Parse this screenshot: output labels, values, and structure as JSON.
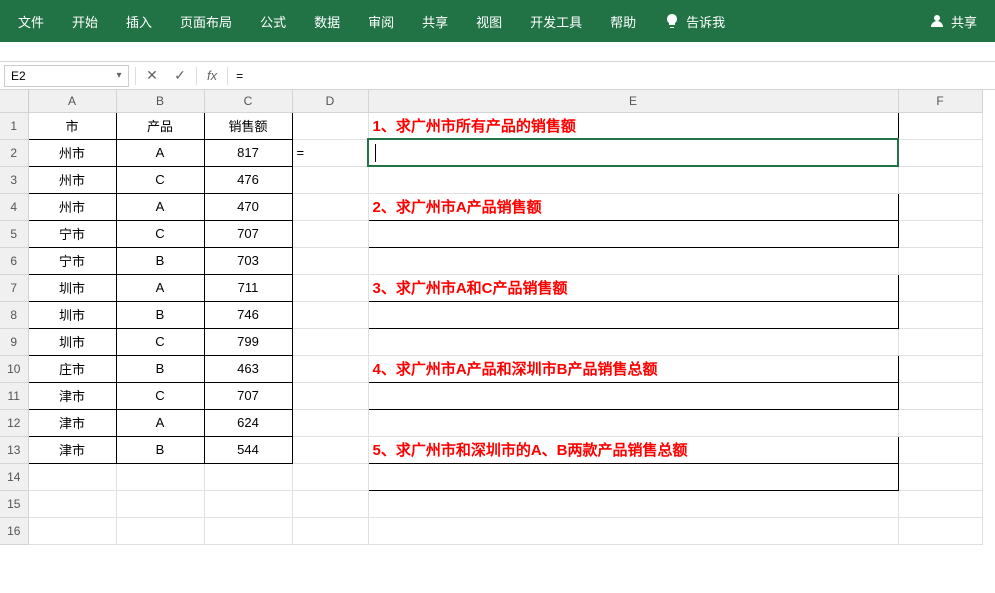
{
  "ribbon": {
    "tabs": [
      "文件",
      "开始",
      "插入",
      "页面布局",
      "公式",
      "数据",
      "审阅",
      "共享",
      "视图",
      "开发工具",
      "帮助"
    ],
    "tell_me": "告诉我",
    "share": "共享"
  },
  "formula_bar": {
    "name_box": "E2",
    "cancel": "✕",
    "confirm": "✓",
    "fx": "fx",
    "formula": "="
  },
  "columns": [
    "A",
    "B",
    "C",
    "D",
    "E",
    "F"
  ],
  "headers": {
    "A": "市",
    "B": "产品",
    "C": "销售额"
  },
  "table": [
    {
      "city": "州市",
      "product": "A",
      "sales": "817"
    },
    {
      "city": "州市",
      "product": "C",
      "sales": "476"
    },
    {
      "city": "州市",
      "product": "A",
      "sales": "470"
    },
    {
      "city": "宁市",
      "product": "C",
      "sales": "707"
    },
    {
      "city": "宁市",
      "product": "B",
      "sales": "703"
    },
    {
      "city": "圳市",
      "product": "A",
      "sales": "711"
    },
    {
      "city": "圳市",
      "product": "B",
      "sales": "746"
    },
    {
      "city": "圳市",
      "product": "C",
      "sales": "799"
    },
    {
      "city": "庄市",
      "product": "B",
      "sales": "463"
    },
    {
      "city": "津市",
      "product": "C",
      "sales": "707"
    },
    {
      "city": "津市",
      "product": "A",
      "sales": "624"
    },
    {
      "city": "津市",
      "product": "B",
      "sales": "544"
    }
  ],
  "d2": "=",
  "tasks": {
    "e1": "1、求广州市所有产品的销售额",
    "e4": "2、求广州市A产品销售额",
    "e7": "3、求广州市A和C产品销售额",
    "e10": "4、求广州市A产品和深圳市B产品销售总额",
    "e13": "5、求广州市和深圳市的A、B两款产品销售总额"
  },
  "row_count": 16
}
